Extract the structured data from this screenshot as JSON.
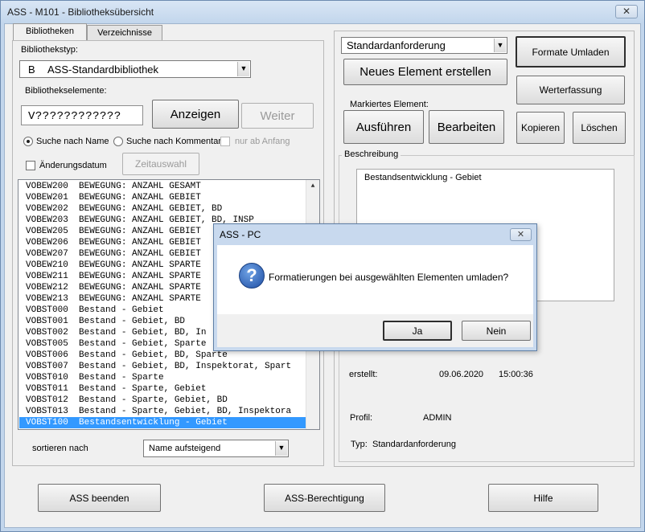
{
  "window": {
    "title": "ASS - M101 - Bibliotheksübersicht",
    "close_glyph": "✕"
  },
  "tabs": [
    {
      "label": "Bibliotheken"
    },
    {
      "label": "Verzeichnisse"
    }
  ],
  "left": {
    "bibliothekstyp_label": "Bibliothekstyp:",
    "bibliothekstyp_code": "B",
    "bibliothekstyp_value": "ASS-Standardbibliothek",
    "elemente_label": "Bibliothekselemente:",
    "elemente_input": "V????????????",
    "anzeigen_label": "Anzeigen",
    "weiter_label": "Weiter",
    "radio_name_label": "Suche nach Name",
    "radio_kommentar_label": "Suche nach Kommentar",
    "check_anfang_label": "nur ab Anfang",
    "check_aenderung_label": "Änderungsdatum",
    "zeitauswahl_label": "Zeitauswahl",
    "list_items": [
      "VOBEW200  BEWEGUNG: ANZAHL GESAMT",
      "VOBEW201  BEWEGUNG: ANZAHL GEBIET",
      "VOBEW202  BEWEGUNG: ANZAHL GEBIET, BD",
      "VOBEW203  BEWEGUNG: ANZAHL GEBIET, BD, INSP",
      "VOBEW205  BEWEGUNG: ANZAHL GEBIET",
      "VOBEW206  BEWEGUNG: ANZAHL GEBIET",
      "VOBEW207  BEWEGUNG: ANZAHL GEBIET",
      "VOBEW210  BEWEGUNG: ANZAHL SPARTE",
      "VOBEW211  BEWEGUNG: ANZAHL SPARTE",
      "VOBEW212  BEWEGUNG: ANZAHL SPARTE",
      "VOBEW213  BEWEGUNG: ANZAHL SPARTE",
      "VOBST000  Bestand - Gebiet",
      "VOBST001  Bestand - Gebiet, BD",
      "VOBST002  Bestand - Gebiet, BD, In",
      "VOBST005  Bestand - Gebiet, Sparte",
      "VOBST006  Bestand - Gebiet, BD, Sparte",
      "VOBST007  Bestand - Gebiet, BD, Inspektorat, Spart",
      "VOBST010  Bestand - Sparte",
      "VOBST011  Bestand - Sparte, Gebiet",
      "VOBST012  Bestand - Sparte, Gebiet, BD",
      "VOBST013  Bestand - Sparte, Gebiet, BD, Inspektora",
      "VOBST100  Bestandsentwicklung - Gebiet"
    ],
    "selected_index": 21,
    "sortieren_label": "sortieren nach",
    "sortieren_value": "Name aufsteigend"
  },
  "right": {
    "anforderung_value": "Standardanforderung",
    "neues_element_label": "Neues Element erstellen",
    "markiertes_label": "Markiertes Element:",
    "ausfuehren_label": "Ausführen",
    "bearbeiten_label": "Bearbeiten",
    "formate_label": "Formate Umladen",
    "werterfassung_label": "Werterfassung",
    "kopieren_label": "Kopieren",
    "loeschen_label": "Löschen",
    "beschreibung_legend": "Beschreibung",
    "beschreibung_text": "Bestandsentwicklung - Gebiet",
    "erstellt_label": "erstellt:",
    "erstellt_date": "09.06.2020",
    "erstellt_time": "15:00:36",
    "profil_label": "Profil:",
    "profil_value": "ADMIN",
    "typ_label": "Typ:",
    "typ_value": "Standardanforderung"
  },
  "bottom": {
    "beenden_label": "ASS beenden",
    "berechtigung_label": "ASS-Berechtigung",
    "hilfe_label": "Hilfe"
  },
  "dialog": {
    "title": "ASS - PC",
    "close_glyph": "✕",
    "icon_glyph": "?",
    "message": "Formatierungen bei ausgewählten Elementen umladen?",
    "ja_label": "Ja",
    "nein_label": "Nein"
  },
  "glyphs": {
    "dropdown": "▼",
    "scroll_up": "▲"
  },
  "icons": {
    "dialog_icon": "question-icon"
  }
}
